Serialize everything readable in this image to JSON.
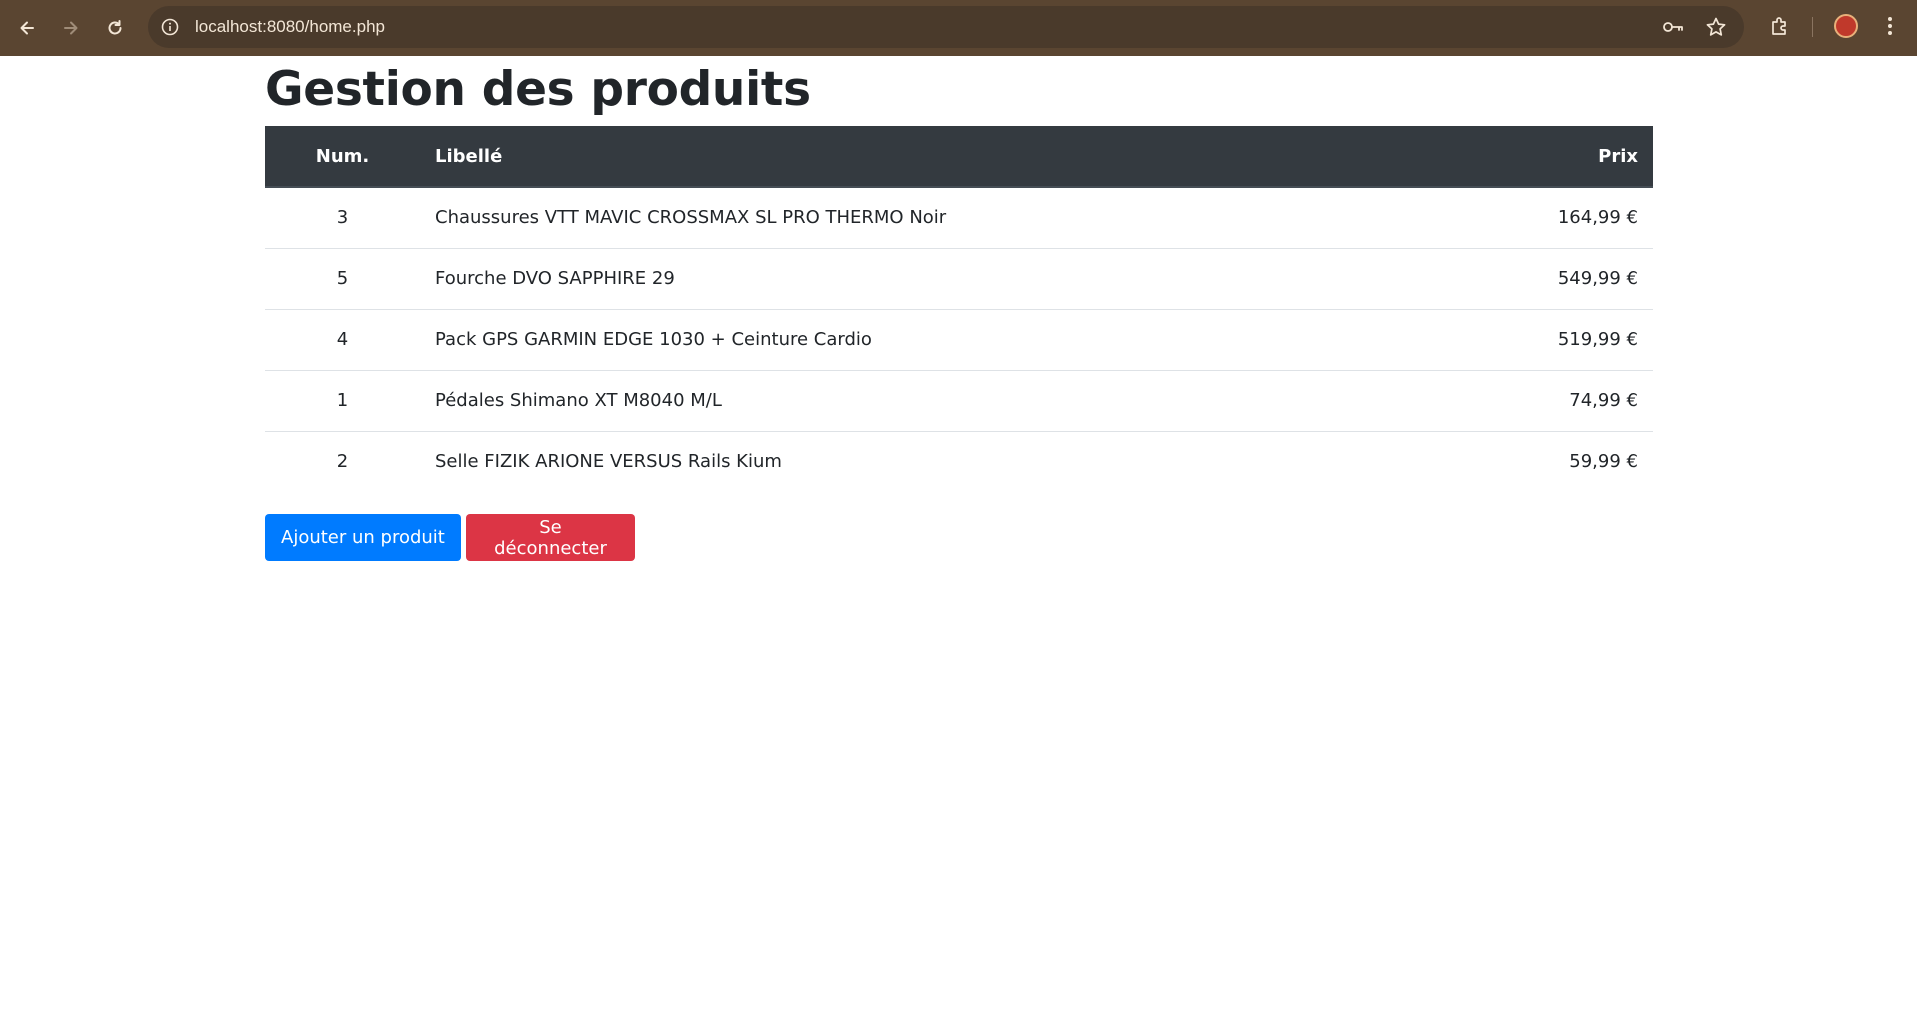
{
  "browser": {
    "url": "localhost:8080/home.php",
    "icons": [
      "back-arrow-icon",
      "forward-arrow-icon",
      "reload-icon",
      "site-info-icon",
      "password-key-icon",
      "bookmark-star-icon",
      "extensions-icon",
      "profile-avatar-icon",
      "more-menu-icon"
    ]
  },
  "page": {
    "title": "Gestion des produits"
  },
  "table": {
    "headers": {
      "num": "Num.",
      "libelle": "Libellé",
      "prix": "Prix"
    },
    "rows": [
      {
        "num": "3",
        "libelle": "Chaussures VTT MAVIC CROSSMAX SL PRO THERMO Noir",
        "prix": "164,99 €"
      },
      {
        "num": "5",
        "libelle": "Fourche DVO SAPPHIRE 29",
        "prix": "549,99 €"
      },
      {
        "num": "4",
        "libelle": "Pack GPS GARMIN EDGE 1030 + Ceinture Cardio",
        "prix": "519,99 €"
      },
      {
        "num": "1",
        "libelle": "Pédales Shimano XT M8040 M/L",
        "prix": "74,99 €"
      },
      {
        "num": "2",
        "libelle": "Selle FIZIK ARIONE VERSUS Rails Kium",
        "prix": "59,99 €"
      }
    ]
  },
  "actions": {
    "add_label": "Ajouter un produit",
    "logout_label": "Se déconnecter"
  },
  "colors": {
    "browser_bar": "#5a4531",
    "table_header": "#343a40",
    "primary": "#007bff",
    "danger": "#dc3545"
  }
}
